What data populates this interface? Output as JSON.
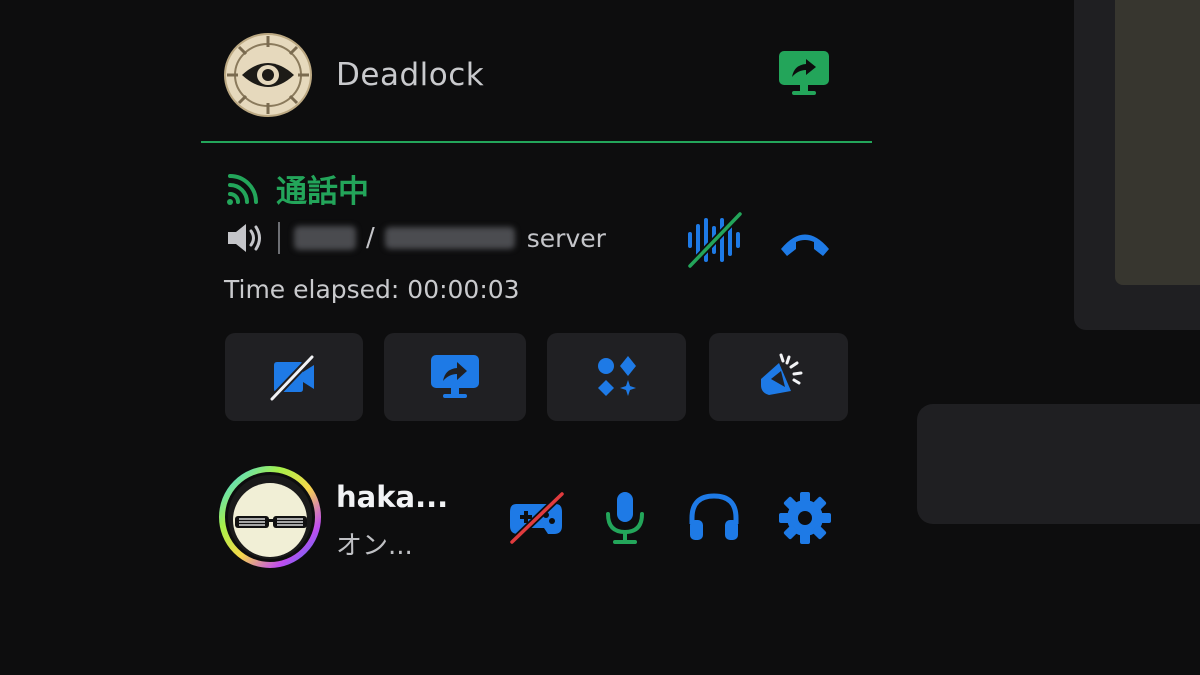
{
  "activity": {
    "game_name": "Deadlock"
  },
  "voice": {
    "status_title": "通話中",
    "separator": "/",
    "server_suffix": "server",
    "elapsed": "Time elapsed: 00:00:03"
  },
  "actions": [
    {
      "name": "camera-off-button",
      "icon": "camera-off-icon"
    },
    {
      "name": "share-screen-button",
      "icon": "share-screen-icon"
    },
    {
      "name": "activities-button",
      "icon": "activities-icon"
    },
    {
      "name": "soundboard-button",
      "icon": "soundboard-icon"
    }
  ],
  "user": {
    "name": "haka...",
    "status": "オン..."
  },
  "colors": {
    "accent_green": "#23a55a",
    "accent_blue": "#1e7ae6",
    "danger_red": "#e03b3e",
    "button_bg": "#202023",
    "background": "#0d0d0e"
  }
}
